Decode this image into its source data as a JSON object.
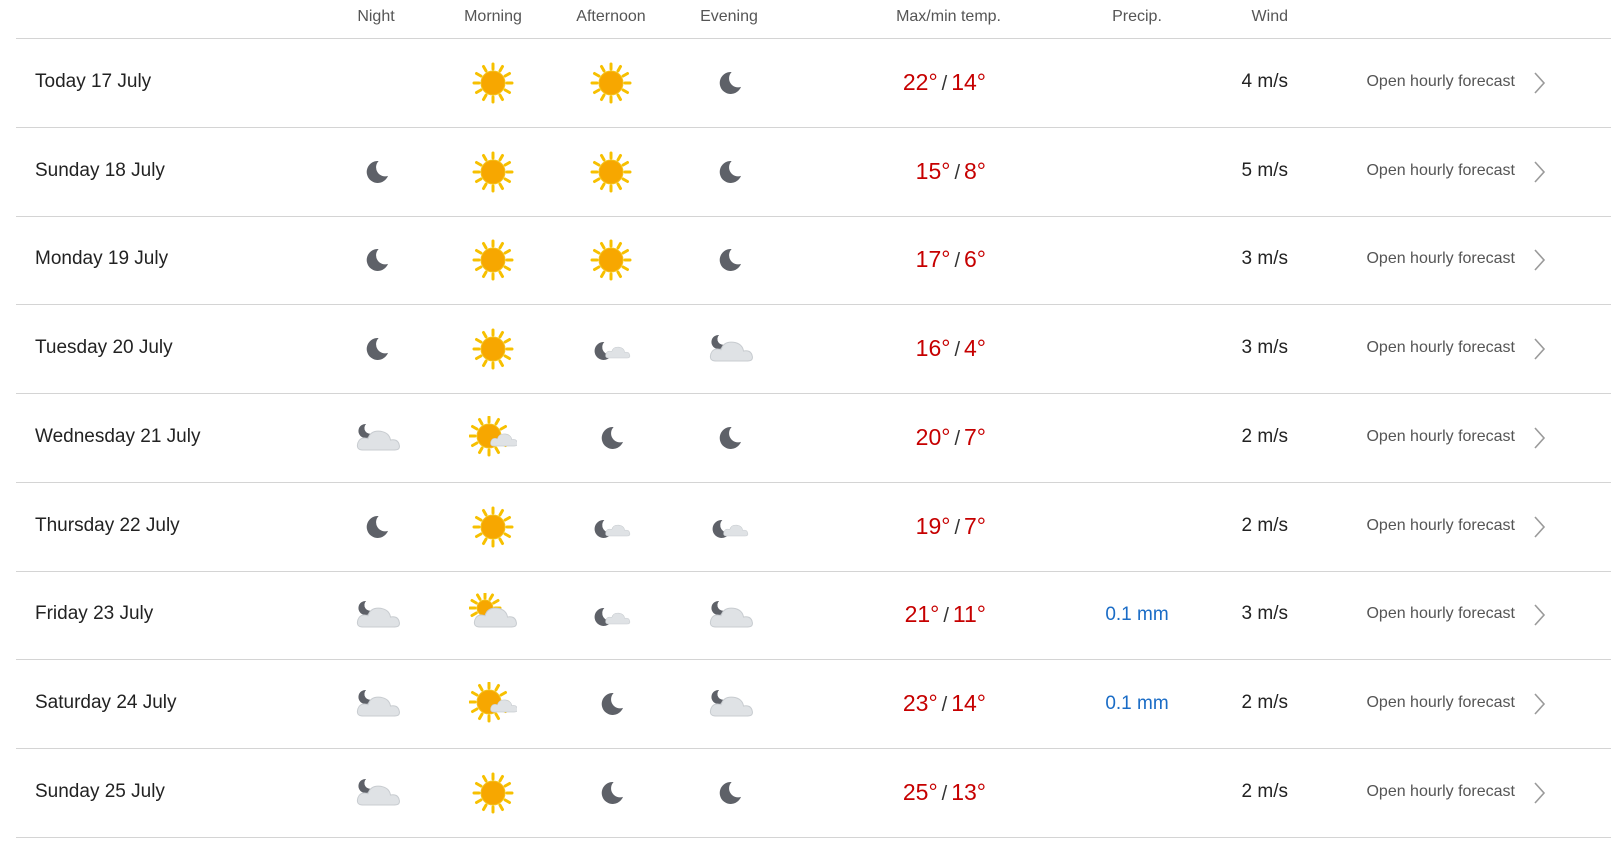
{
  "header": {
    "night": "Night",
    "morning": "Morning",
    "afternoon": "Afternoon",
    "evening": "Evening",
    "temp": "Max/min temp.",
    "precip": "Precip.",
    "wind": "Wind"
  },
  "rows": [
    {
      "day": "Today 17 July",
      "icons": [
        "",
        "sun",
        "sun",
        "moon"
      ],
      "max": "22°",
      "min": "14°",
      "sep": "/",
      "precip": "",
      "wind": "4 m/s",
      "link": "Open hourly forecast"
    },
    {
      "day": "Sunday 18 July",
      "icons": [
        "moon",
        "sun",
        "sun",
        "moon"
      ],
      "max": "15°",
      "min": "8°",
      "sep": "/",
      "precip": "",
      "wind": "5 m/s",
      "link": "Open hourly forecast"
    },
    {
      "day": "Monday 19 July",
      "icons": [
        "moon",
        "sun",
        "sun",
        "moon"
      ],
      "max": "17°",
      "min": "6°",
      "sep": "/",
      "precip": "",
      "wind": "3 m/s",
      "link": "Open hourly forecast"
    },
    {
      "day": "Tuesday 20 July",
      "icons": [
        "moon",
        "sun",
        "moon-cloud",
        "cloud-moon"
      ],
      "max": "16°",
      "min": "4°",
      "sep": "/",
      "precip": "",
      "wind": "3 m/s",
      "link": "Open hourly forecast"
    },
    {
      "day": "Wednesday 21 July",
      "icons": [
        "cloud-moon",
        "sun-cloud",
        "moon",
        "moon"
      ],
      "max": "20°",
      "min": "7°",
      "sep": "/",
      "precip": "",
      "wind": "2 m/s",
      "link": "Open hourly forecast"
    },
    {
      "day": "Thursday 22 July",
      "icons": [
        "moon",
        "sun",
        "moon-cloud",
        "moon-cloud"
      ],
      "max": "19°",
      "min": "7°",
      "sep": "/",
      "precip": "",
      "wind": "2 m/s",
      "link": "Open hourly forecast"
    },
    {
      "day": "Friday 23 July",
      "icons": [
        "cloud-moon",
        "cloud-sun",
        "moon-cloud",
        "cloud-moon"
      ],
      "max": "21°",
      "min": "11°",
      "sep": "/",
      "precip": "0.1 mm",
      "wind": "3 m/s",
      "link": "Open hourly forecast"
    },
    {
      "day": "Saturday 24 July",
      "icons": [
        "cloud-moon",
        "sun-cloud",
        "moon",
        "cloud-moon"
      ],
      "max": "23°",
      "min": "14°",
      "sep": "/",
      "precip": "0.1 mm",
      "wind": "2 m/s",
      "link": "Open hourly forecast"
    },
    {
      "day": "Sunday 25 July",
      "icons": [
        "cloud-moon",
        "sun",
        "moon",
        "moon"
      ],
      "max": "25°",
      "min": "13°",
      "sep": "/",
      "precip": "",
      "wind": "2 m/s",
      "link": "Open hourly forecast"
    }
  ],
  "colors": {
    "temperature": "#c60000",
    "precipitation": "#1a6cc6",
    "sun": "#f7a700",
    "moon": "#5e6168",
    "cloud": "#d9dcdf",
    "divider": "#d4d4d4"
  }
}
